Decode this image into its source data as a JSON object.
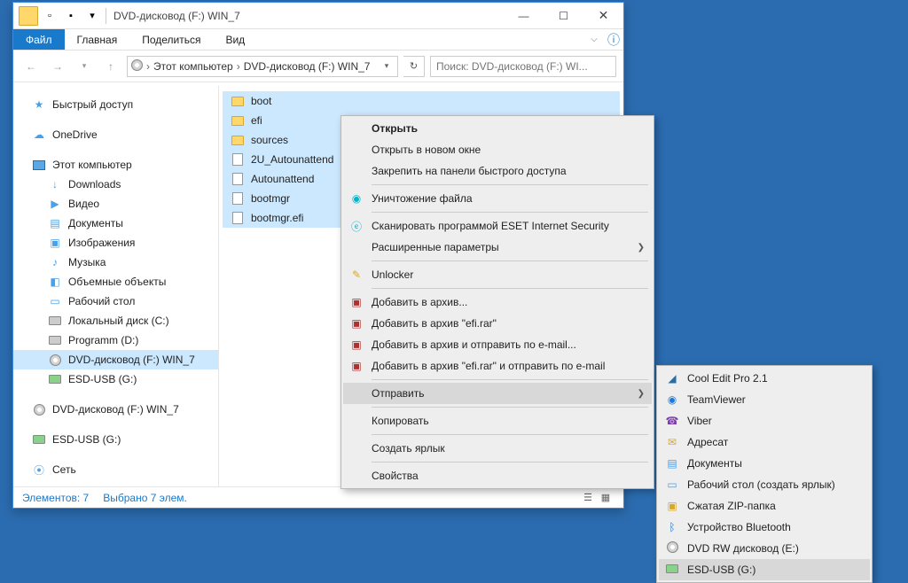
{
  "titlebar": {
    "title": "DVD-дисковод (F:) WIN_7"
  },
  "ribbon": {
    "file": "Файл",
    "home": "Главная",
    "share": "Поделиться",
    "view": "Вид"
  },
  "nav": {
    "crumb1": "Этот компьютер",
    "crumb2": "DVD-дисковод (F:) WIN_7",
    "search_placeholder": "Поиск: DVD-дисковод (F:) WI..."
  },
  "sidebar": {
    "quick": "Быстрый доступ",
    "onedrive": "OneDrive",
    "thispc": "Этот компьютер",
    "downloads": "Downloads",
    "video": "Видео",
    "docs": "Документы",
    "images": "Изображения",
    "music": "Музыка",
    "objects3d": "Объемные объекты",
    "desktop": "Рабочий стол",
    "localc": "Локальный диск (C:)",
    "programm": "Programm (D:)",
    "dvd": "DVD-дисковод (F:) WIN_7",
    "esd": "ESD-USB (G:)",
    "dvd2": "DVD-дисковод (F:) WIN_7",
    "esd2": "ESD-USB (G:)",
    "network": "Сеть"
  },
  "files": {
    "boot": "boot",
    "efi": "efi",
    "sources": "sources",
    "auto2u": "2U_Autounattend",
    "auto": "Autounattend",
    "bootmgr": "bootmgr",
    "bootmgrefi": "bootmgr.efi"
  },
  "status": {
    "items": "Элементов: 7",
    "selected": "Выбрано 7 элем."
  },
  "ctx1": {
    "open": "Открыть",
    "opennew": "Открыть в новом окне",
    "pin": "Закрепить на панели быстрого доступа",
    "destroy": "Уничтожение файла",
    "scan": "Сканировать программой ESET Internet Security",
    "advparams": "Расширенные параметры",
    "unlocker": "Unlocker",
    "addarch": "Добавить в архив...",
    "addefi": "Добавить в архив \"efi.rar\"",
    "addemail": "Добавить в архив и отправить по e-mail...",
    "addefiemail": "Добавить в архив \"efi.rar\" и отправить по e-mail",
    "send": "Отправить",
    "copy": "Копировать",
    "shortcut": "Создать ярлык",
    "props": "Свойства"
  },
  "ctx2": {
    "cooledit": "Cool Edit Pro 2.1",
    "teamviewer": "TeamViewer",
    "viber": "Viber",
    "recipient": "Адресат",
    "docs": "Документы",
    "desktop": "Рабочий стол (создать ярлык)",
    "zip": "Сжатая ZIP-папка",
    "bluetooth": "Устройство Bluetooth",
    "dvdrw": "DVD RW дисковод (E:)",
    "esd": "ESD-USB (G:)"
  }
}
